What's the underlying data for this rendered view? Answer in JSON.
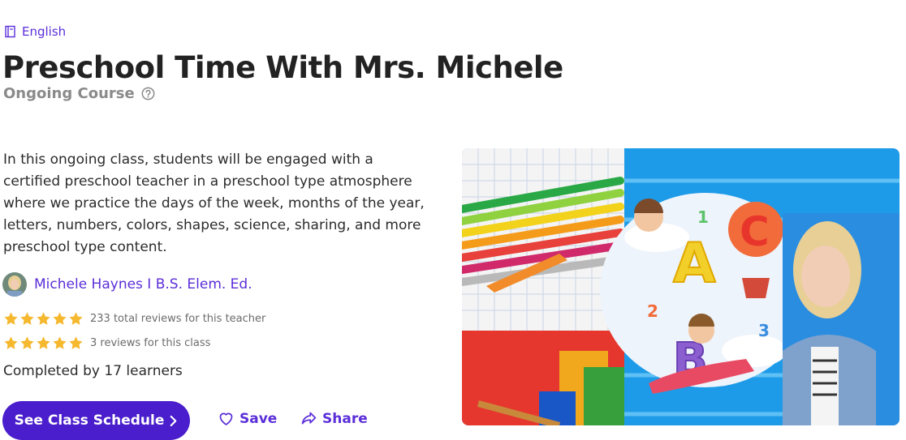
{
  "language": {
    "label": "English",
    "icon": "book-icon"
  },
  "title": "Preschool Time With Mrs. Michele",
  "course_type": {
    "label": "Ongoing Course",
    "icon": "help-icon"
  },
  "description": "In this ongoing class, students will be engaged with a certified preschool teacher in a preschool type atmosphere where we practice the days of the week, months of the year, letters, numbers, colors, shapes, science, sharing, and more preschool type content.",
  "teacher": {
    "name": "Michele Haynes I B.S. Elem. Ed."
  },
  "ratings": {
    "teacher": {
      "stars": 5,
      "text": "233 total reviews for this teacher"
    },
    "class": {
      "stars": 5,
      "text": "3 reviews for this class"
    }
  },
  "completed": "Completed by 17 learners",
  "actions": {
    "schedule_label": "See Class Schedule",
    "save_label": "Save",
    "share_label": "Share"
  },
  "hero_image": {
    "letters": [
      "A",
      "B",
      "C"
    ],
    "numbers": [
      "1",
      "2",
      "3"
    ]
  },
  "colors": {
    "accent": "#5b2ed8",
    "primary_button": "#4a1ecc",
    "star": "#f5b82e",
    "hero_blue": "#1e9be8"
  }
}
